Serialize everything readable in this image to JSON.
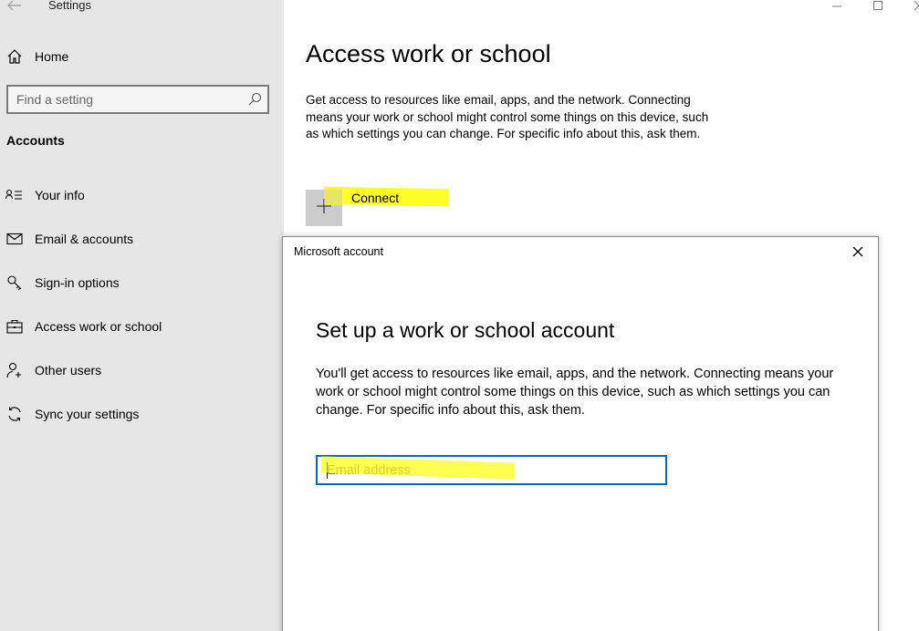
{
  "window": {
    "title": "Settings"
  },
  "sidebar": {
    "home_label": "Home",
    "search": {
      "placeholder": "Find a setting"
    },
    "section_heading": "Accounts",
    "items": [
      {
        "label": "Your info",
        "icon": "person-list-icon"
      },
      {
        "label": "Email & accounts",
        "icon": "mail-icon"
      },
      {
        "label": "Sign-in options",
        "icon": "key-icon"
      },
      {
        "label": "Access work or school",
        "icon": "briefcase-icon"
      },
      {
        "label": "Other users",
        "icon": "person-add-icon"
      },
      {
        "label": "Sync your settings",
        "icon": "sync-icon"
      }
    ]
  },
  "main": {
    "title": "Access work or school",
    "description": "Get access to resources like email, apps, and the network. Connecting means your work or school might control some things on this device, such as which settings you can change. For specific info about this, ask them.",
    "connect_label": "Connect"
  },
  "dialog": {
    "title": "Microsoft account",
    "heading": "Set up a work or school account",
    "description": "You'll get access to resources like email, apps, and the network. Connecting means your work or school might control some things on this device, such as which settings you can change. For specific info about this, ask them.",
    "email": {
      "placeholder": "Email address",
      "value": ""
    }
  },
  "colors": {
    "sidebar_bg": "#e6e6e6",
    "accent": "#0067c0",
    "highlight": "#ffff00"
  }
}
